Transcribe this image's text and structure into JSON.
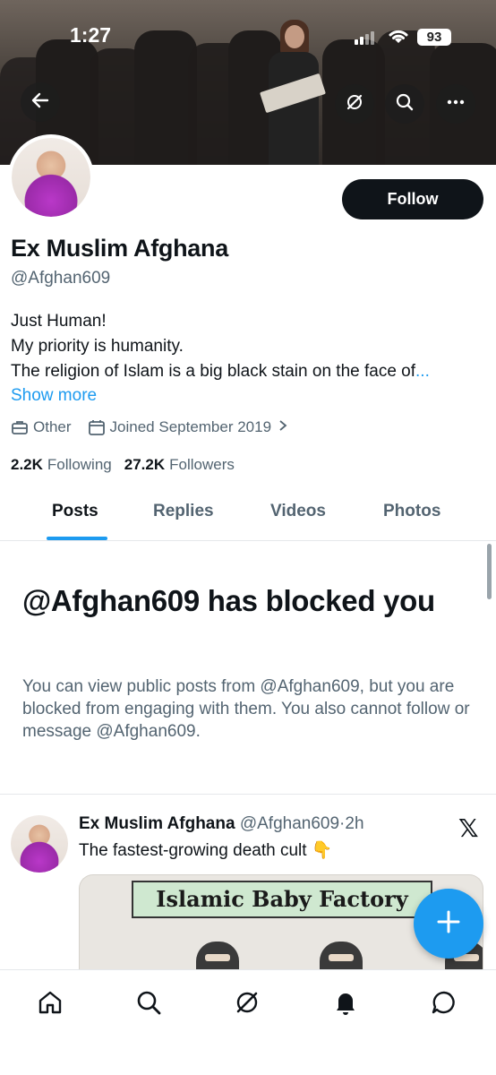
{
  "status_bar": {
    "time": "1:27",
    "battery": "93"
  },
  "banner": {
    "back_icon": "arrow-left-icon",
    "grok_icon": "grok-icon",
    "search_icon": "search-icon",
    "more_icon": "more-horizontal-icon"
  },
  "profile": {
    "display_name": "Ex Muslim Afghana",
    "handle": "@Afghan609",
    "follow_label": "Follow",
    "bio_lines": [
      "Just Human!",
      "My priority is humanity.",
      "The religion of Islam is a big black stain on the face of"
    ],
    "bio_ellipsis": "...",
    "show_more": "Show more",
    "category": "Other",
    "joined": "Joined September 2019",
    "following_count": "2.2K",
    "following_label": "Following",
    "followers_count": "27.2K",
    "followers_label": "Followers"
  },
  "tabs": [
    {
      "label": "Posts",
      "active": true
    },
    {
      "label": "Replies",
      "active": false
    },
    {
      "label": "Videos",
      "active": false
    },
    {
      "label": "Photos",
      "active": false
    }
  ],
  "blocked": {
    "title": "@Afghan609 has blocked you",
    "description": "You can view public posts from @Afghan609, but you are blocked from engaging with them. You also cannot follow or message @Afghan609."
  },
  "post": {
    "author_name": "Ex Muslim Afghana",
    "author_handle": "@Afghan609",
    "separator": "·",
    "time": "2h",
    "text": "The fastest-growing death cult 👇",
    "image_caption": "Islamic Baby Factory",
    "platform_icon": "x-logo-icon"
  },
  "fab": {
    "icon": "plus-icon"
  },
  "bottom_nav": [
    "home-icon",
    "search-icon",
    "grok-icon",
    "notifications-icon",
    "messages-icon"
  ],
  "colors": {
    "accent": "#1d9bf0",
    "text": "#0f1419",
    "secondary": "#536471",
    "button_dark": "#0f1419"
  }
}
